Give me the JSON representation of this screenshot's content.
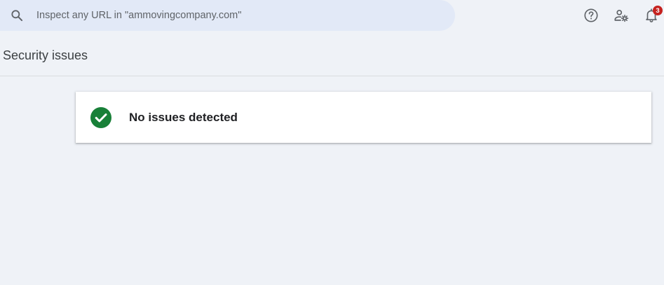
{
  "search": {
    "placeholder": "Inspect any URL in \"ammovingcompany.com\"",
    "value": ""
  },
  "header_icons": {
    "help": "help-icon",
    "user_settings": "user-settings-icon",
    "notifications": "bell-icon",
    "notification_count": "3"
  },
  "page": {
    "title": "Security issues"
  },
  "status_card": {
    "icon": "check-circle-icon",
    "message": "No issues detected"
  },
  "colors": {
    "background": "#eff2f7",
    "search_bg": "#e2e9f7",
    "success_green": "#188038",
    "badge_red": "#c5221f"
  }
}
